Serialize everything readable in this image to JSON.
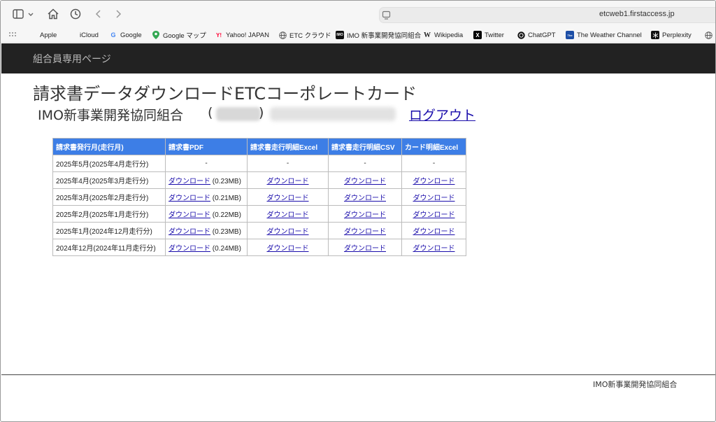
{
  "browser": {
    "url": "etcweb1.firstaccess.jp",
    "bookmarks": [
      {
        "label": "Apple",
        "icon": "apple-icon"
      },
      {
        "label": "iCloud",
        "icon": "apple-icon"
      },
      {
        "label": "Google",
        "icon": "google-icon"
      },
      {
        "label": "Google マップ",
        "icon": "google-maps-icon"
      },
      {
        "label": "Yahoo! JAPAN",
        "icon": "yahoo-icon"
      },
      {
        "label": "ETC クラウド",
        "icon": "globe-icon"
      },
      {
        "label": "IMO 新事業開発協同組合",
        "icon": "imo-icon"
      },
      {
        "label": "Wikipedia",
        "icon": "wikipedia-icon"
      },
      {
        "label": "Twitter",
        "icon": "x-icon"
      },
      {
        "label": "ChatGPT",
        "icon": "chatgpt-icon"
      },
      {
        "label": "The Weather Channel",
        "icon": "weather-icon"
      },
      {
        "label": "Perplexity",
        "icon": "perplexity-icon"
      }
    ]
  },
  "nav": {
    "title": "組合員専用ページ"
  },
  "main": {
    "title": "請求書データダウンロードETCコーポレートカード",
    "org_name": "IMO新事業開発協同組合",
    "paren_open": "(",
    "paren_close": ")",
    "logout": "ログアウト"
  },
  "table": {
    "headers": [
      "請求書発行月(走行月)",
      "請求書PDF",
      "請求書走行明細Excel",
      "請求書走行明細CSV",
      "カード明細Excel"
    ],
    "download_label": "ダウンロード",
    "rows": [
      {
        "month": "2025年5月(2025年4月走行分)",
        "pdf": "-",
        "pdf_size": "",
        "excel": "-",
        "csv": "-",
        "card": "-"
      },
      {
        "month": "2025年4月(2025年3月走行分)",
        "pdf": "ダウンロード",
        "pdf_size": "(0.23MB)",
        "excel": "ダウンロード",
        "csv": "ダウンロード",
        "card": "ダウンロード"
      },
      {
        "month": "2025年3月(2025年2月走行分)",
        "pdf": "ダウンロード",
        "pdf_size": "(0.21MB)",
        "excel": "ダウンロード",
        "csv": "ダウンロード",
        "card": "ダウンロード"
      },
      {
        "month": "2025年2月(2025年1月走行分)",
        "pdf": "ダウンロード",
        "pdf_size": "(0.22MB)",
        "excel": "ダウンロード",
        "csv": "ダウンロード",
        "card": "ダウンロード"
      },
      {
        "month": "2025年1月(2024年12月走行分)",
        "pdf": "ダウンロード",
        "pdf_size": "(0.23MB)",
        "excel": "ダウンロード",
        "csv": "ダウンロード",
        "card": "ダウンロード"
      },
      {
        "month": "2024年12月(2024年11月走行分)",
        "pdf": "ダウンロード",
        "pdf_size": "(0.24MB)",
        "excel": "ダウンロード",
        "csv": "ダウンロード",
        "card": "ダウンロード"
      }
    ]
  },
  "footer": {
    "text": "IMO新事業開発協同組合"
  },
  "colors": {
    "navbar_bg": "#222222",
    "table_header_bg": "#3d7ee6",
    "link": "#1a0dab"
  }
}
